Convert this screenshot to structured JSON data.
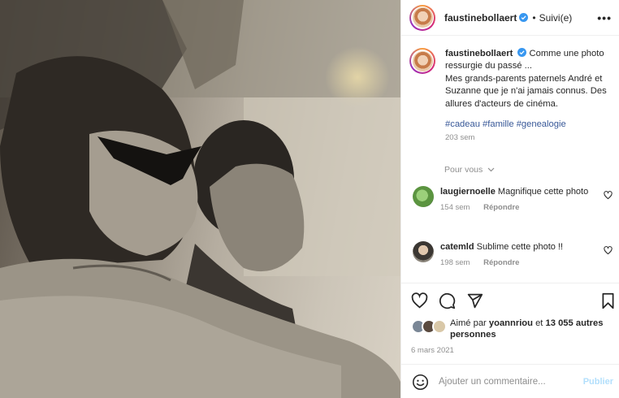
{
  "post": {
    "username": "faustinebollaert",
    "header_dot": "•",
    "follow_label": "Suivi(e)",
    "more_label": "•••",
    "caption": "Comme une photo ressurgie du passé ... Mes grands-parents paternels André et Suzanne que je n'ai jamais connus. Des allures d'acteurs de cinéma.",
    "caption_line1": "Comme une photo ressurgie du passé ...",
    "caption_line2": "Mes grands-parents paternels André et Suzanne que je n'ai jamais connus. Des allures d'acteurs de cinéma.",
    "hashtags": "#cadeau #famille #genealogie",
    "caption_time": "203 sem",
    "see_more": "Pour vous"
  },
  "comments": [
    {
      "username": "laugiernoelle",
      "text": "Magnifique cette photo",
      "time": "154 sem",
      "reply": "Répondre",
      "avatar_color": "#6aa84f"
    },
    {
      "username": "catemld",
      "text": "Sublime cette photo !!",
      "time": "198 sem",
      "reply": "Répondre",
      "avatar_color": "#4a4a4a"
    }
  ],
  "likes": {
    "prefix": "Aimé par",
    "user": "yoannriou",
    "conjunction": "et",
    "count": "13 055 autres personnes"
  },
  "post_date": "6 mars 2021",
  "comment_box": {
    "placeholder": "Ajouter un commentaire...",
    "publish_label": "Publier"
  },
  "icons": {
    "verified": "verified-badge-icon",
    "heart": "heart-icon",
    "comment": "comment-icon",
    "share": "share-icon",
    "save": "bookmark-icon",
    "emoji": "emoji-icon"
  },
  "colors": {
    "verified": "#3897f0",
    "link": "#385898",
    "muted": "#8e8e8e",
    "publish": "#b2dffc"
  }
}
